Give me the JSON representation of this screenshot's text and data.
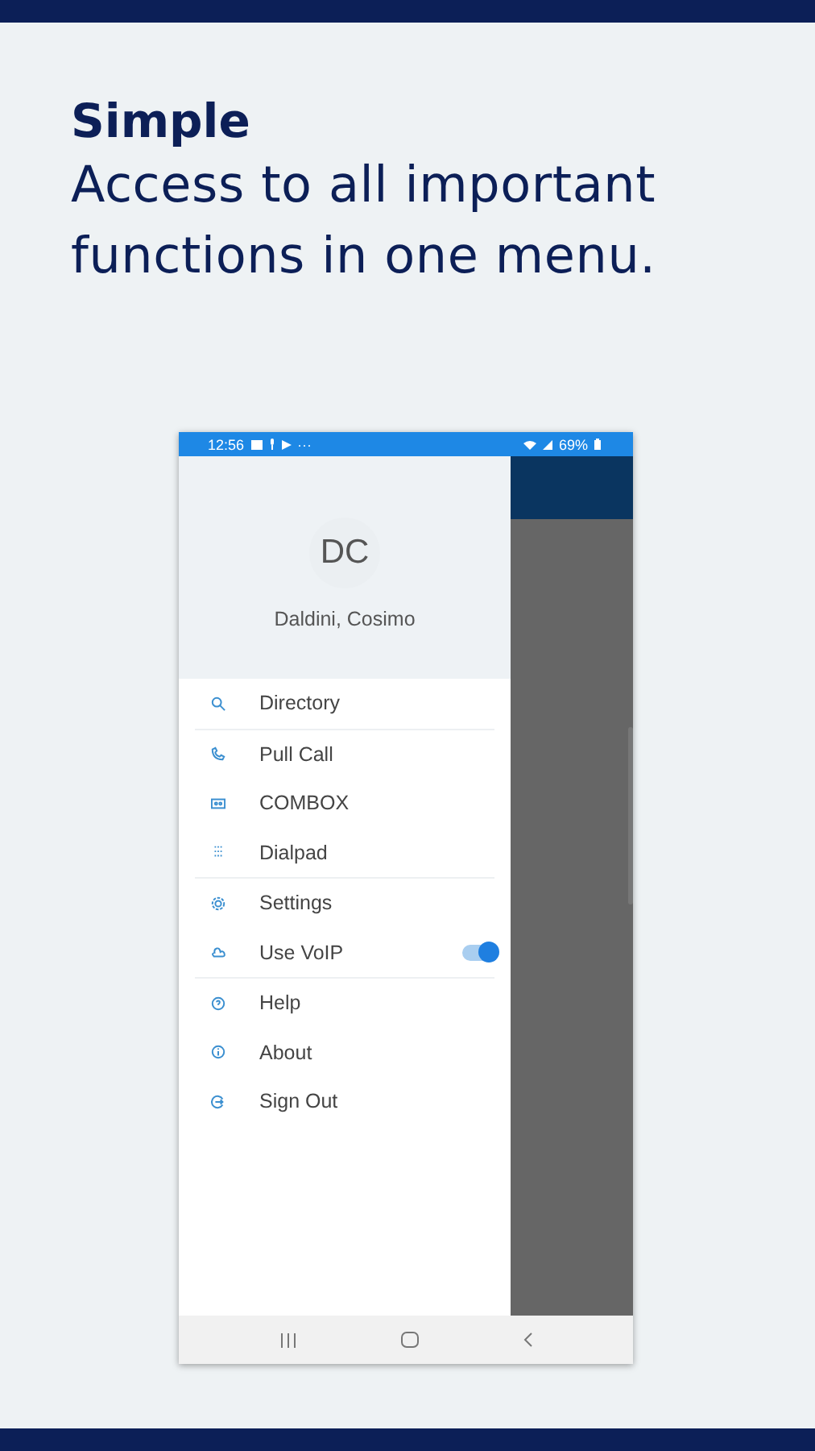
{
  "headline": {
    "title": "Simple",
    "lines": [
      "Access to all important",
      "functions in one menu."
    ]
  },
  "status_bar": {
    "time": "12:56",
    "more": "···",
    "battery": "69%"
  },
  "profile": {
    "initials": "DC",
    "name": "Daldini, Cosimo"
  },
  "menu": {
    "groups": [
      [
        {
          "label": "Directory",
          "kind": "link"
        }
      ],
      [
        {
          "label": "Pull Call",
          "kind": "link"
        },
        {
          "label": "COMBOX",
          "kind": "link"
        },
        {
          "label": "Dialpad",
          "kind": "link"
        }
      ],
      [
        {
          "label": "Settings",
          "kind": "link"
        },
        {
          "label": "Use VoIP",
          "kind": "toggle",
          "on": true
        }
      ],
      [
        {
          "label": "Help",
          "kind": "link"
        },
        {
          "label": "About",
          "kind": "link"
        },
        {
          "label": "Sign Out",
          "kind": "link"
        }
      ]
    ]
  }
}
